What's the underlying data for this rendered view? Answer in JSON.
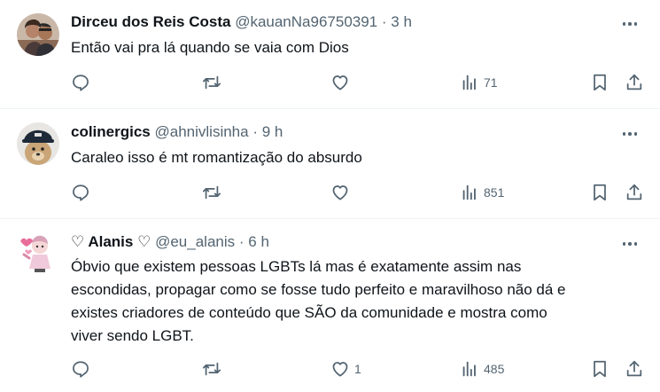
{
  "tweets": [
    {
      "name": "Dirceu dos Reis Costa",
      "handle": "@kauanNa96750391",
      "sep": "·",
      "time": "3 h",
      "text": "Então vai pra lá quando se vaia com Dios",
      "views": "71",
      "likes": "",
      "avatar": "avatar-couple"
    },
    {
      "name": "colinergics",
      "handle": "@ahnivlisinha",
      "sep": "·",
      "time": "9 h",
      "text": "Caraleo isso é mt romantização do absurdo",
      "views": "851",
      "likes": "",
      "avatar": "avatar-dog-cap"
    },
    {
      "name_prefix": "♡",
      "name": "Alanis",
      "name_suffix": "♡",
      "handle": "@eu_alanis",
      "sep": "·",
      "time": "6 h",
      "text_lines": [
        "Óbvio que existem pessoas LGBTs lá mas é exatamente assim nas",
        "escondidas, propagar como se fosse tudo perfeito e maravilhoso não dá e",
        "existes criadores de conteúdo que SÃO da comunidade e mostra como",
        "viver sendo LGBT."
      ],
      "likes": "1",
      "views": "485",
      "avatar": "avatar-cartoon-girl"
    }
  ],
  "icons": {
    "reply": "reply-icon",
    "repost": "repost-icon",
    "like": "heart-icon",
    "views": "views-icon",
    "bookmark": "bookmark-icon",
    "share": "share-icon",
    "more": "more-icon"
  },
  "colors": {
    "text": "#0f1419",
    "secondary": "#536471",
    "divider": "#eff3f4"
  }
}
